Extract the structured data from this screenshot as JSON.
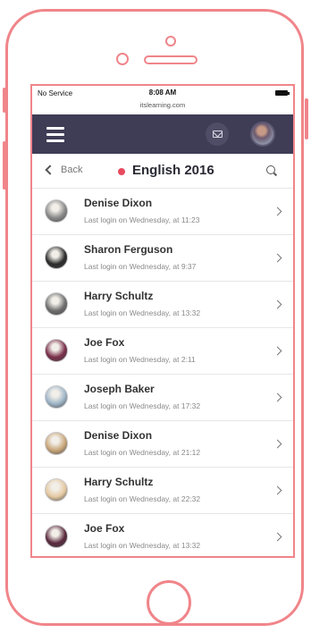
{
  "status_bar": {
    "carrier": "No Service",
    "time": "8:08 AM",
    "url": "itslearning.com"
  },
  "nav": {
    "back_label": "Back",
    "course_title": "English 2016"
  },
  "colors": {
    "header_bg": "#3f3c56",
    "accent_dot": "#e84a5f",
    "frame": "#f0858a"
  },
  "users": [
    {
      "name": "Denise Dixon",
      "last_login": "Last login on Wednesday, at 11:23",
      "avatar_color": "#8a8a8a"
    },
    {
      "name": "Sharon Ferguson",
      "last_login": "Last login on Wednesday, at 9:37",
      "avatar_color": "#2b2b2b"
    },
    {
      "name": "Harry Schultz",
      "last_login": "Last login on Wednesday, at 13:32",
      "avatar_color": "#6f6f6f"
    },
    {
      "name": "Joe Fox",
      "last_login": "Last login on Wednesday, at 2:11",
      "avatar_color": "#7a2f4a"
    },
    {
      "name": "Joseph Baker",
      "last_login": "Last login on Wednesday, at 17:32",
      "avatar_color": "#9fb6c8"
    },
    {
      "name": "Denise Dixon",
      "last_login": "Last login on Wednesday, at 21:12",
      "avatar_color": "#c9a77a"
    },
    {
      "name": "Harry Schultz",
      "last_login": "Last login on Wednesday, at 22:32",
      "avatar_color": "#e5c9a3"
    },
    {
      "name": "Joe Fox",
      "last_login": "Last login on Wednesday, at 13:32",
      "avatar_color": "#5a2a3e"
    }
  ]
}
